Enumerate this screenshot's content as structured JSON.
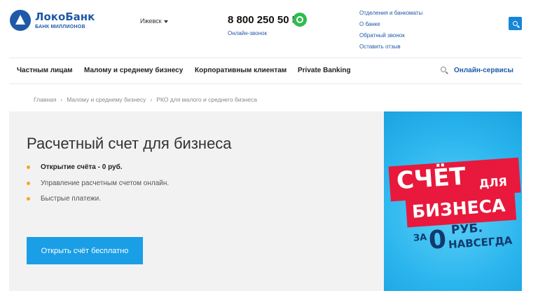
{
  "header": {
    "logo_name": "ЛокоБанк",
    "logo_sub": "БАНК МИЛЛИОНОВ",
    "city": "Ижевск",
    "phone": "8 800 250 50 50",
    "online_call": "Онлайн-звонок",
    "links": [
      "Отделения и банкоматы",
      "О банке",
      "Обратный звонок",
      "Оставить отзыв"
    ]
  },
  "nav": {
    "items": [
      "Частным лицам",
      "Малому и среднему бизнесу",
      "Корпоративным клиентам",
      "Private Banking"
    ],
    "online_services": "Онлайн-сервисы"
  },
  "breadcrumb": [
    "Главная",
    "Малому и среднему бизнесу",
    "РКО для малого и среднего бизнеса"
  ],
  "hero": {
    "title": "Расчетный счет для бизнеса",
    "features": [
      "Открытие счёта - 0 руб.",
      "Управление расчетным счетом онлайн.",
      "Быстрые платежи."
    ],
    "cta": "Открыть счёт бесплатно"
  },
  "promo": {
    "line1": "СЧЁТ",
    "line1b": "ДЛЯ",
    "line2": "БИЗНЕСА",
    "za": "ЗА",
    "zero": "0",
    "rub": "РУБ.",
    "forever": "НАВСЕГДА"
  },
  "colors": {
    "brand_blue": "#1e5aa8",
    "cta_blue": "#1a9ee6",
    "bullet_orange": "#f6a623",
    "promo_red": "#e8193c",
    "promo_sky": "#2cb6ee",
    "whatsapp_green": "#2fbc4e"
  },
  "icons": {
    "logo": "locobank-logo-icon",
    "search": "search-icon",
    "whatsapp": "whatsapp-icon",
    "dropdown": "chevron-down-icon"
  }
}
